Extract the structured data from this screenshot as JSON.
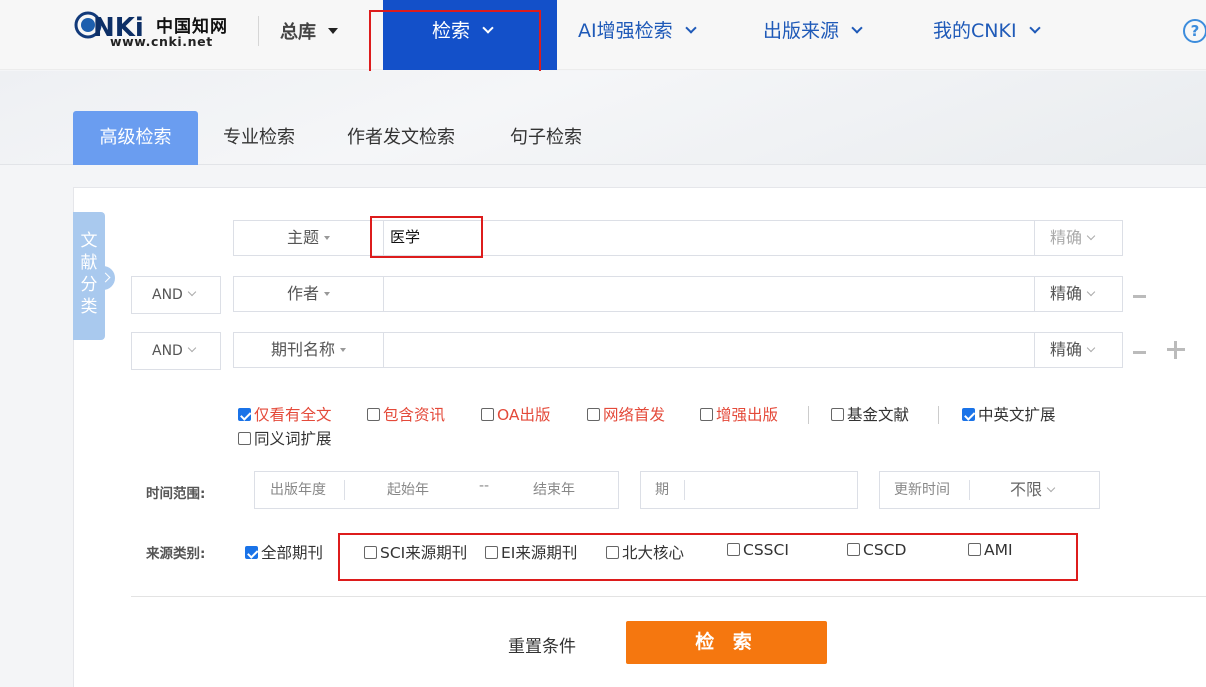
{
  "header": {
    "logo_cn": "中国知网",
    "logo_url": "www.cnki.net",
    "library": "总库",
    "nav": [
      {
        "label": "检索"
      },
      {
        "label": "AI增强检索"
      },
      {
        "label": "出版来源"
      },
      {
        "label": "我的CNKI"
      }
    ],
    "help": "?"
  },
  "tabs": [
    "高级检索",
    "专业检索",
    "作者发文检索",
    "句子检索"
  ],
  "doc_class": [
    "文",
    "献",
    "分",
    "类"
  ],
  "search_rows": [
    {
      "field": "主题",
      "value": "医学",
      "precise": "精确"
    },
    {
      "logic": "AND",
      "field": "作者",
      "value": "",
      "precise": "精确"
    },
    {
      "logic": "AND",
      "field": "期刊名称",
      "value": "",
      "precise": "精确"
    }
  ],
  "options": [
    {
      "label": "仅看有全文",
      "checked": true
    },
    {
      "label": "包含资讯",
      "checked": false
    },
    {
      "label": "OA出版",
      "checked": false
    },
    {
      "label": "网络首发",
      "checked": false
    },
    {
      "label": "增强出版",
      "checked": false
    },
    {
      "label": "基金文献",
      "checked": false
    },
    {
      "label": "中英文扩展",
      "checked": true
    },
    {
      "label": "同义词扩展",
      "checked": false
    }
  ],
  "time_range": {
    "label": "时间范围:",
    "pub_year": "出版年度",
    "start": "起始年",
    "dash": "--",
    "end": "结束年",
    "issue": "期",
    "update": "更新时间",
    "update_value": "不限"
  },
  "source": {
    "label": "来源类别:",
    "items": [
      {
        "label": "全部期刊",
        "checked": true
      },
      {
        "label": "SCI来源期刊",
        "checked": false
      },
      {
        "label": "EI来源期刊",
        "checked": false
      },
      {
        "label": "北大核心",
        "checked": false
      },
      {
        "label": "CSSCI",
        "checked": false
      },
      {
        "label": "CSCD",
        "checked": false
      },
      {
        "label": "AMI",
        "checked": false
      }
    ]
  },
  "actions": {
    "reset": "重置条件",
    "search": "检 索"
  },
  "colors": {
    "nav_active": "#1350c9",
    "tab_active": "#6a9df0",
    "search_button": "#f5770f",
    "highlight": "#dd1c1c"
  }
}
